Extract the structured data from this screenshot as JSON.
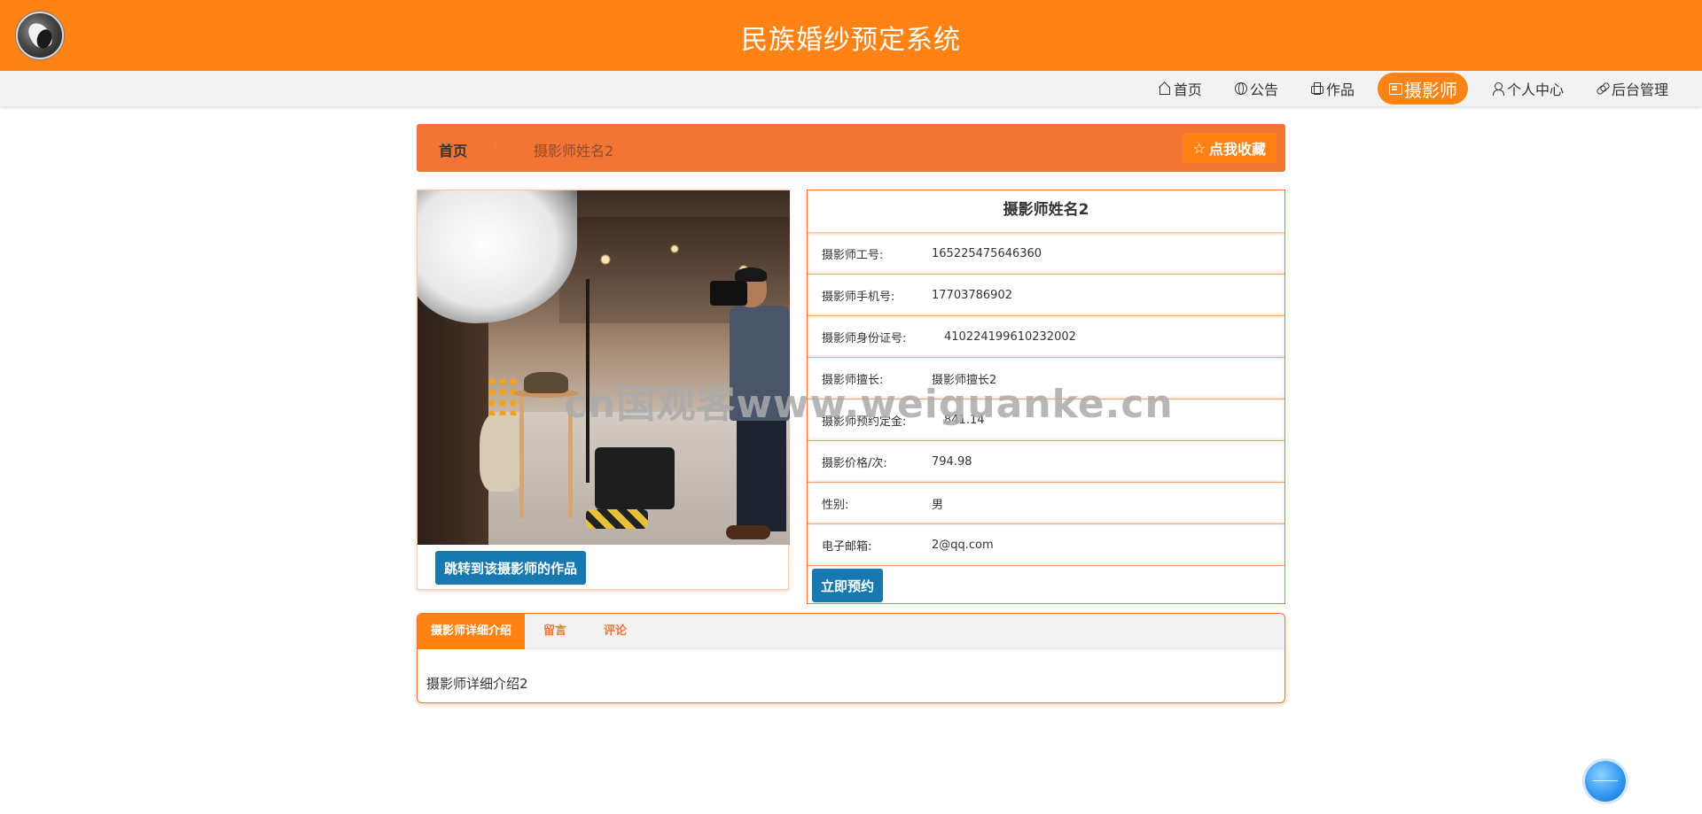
{
  "header": {
    "site_title": "民族婚纱预定系统"
  },
  "nav": {
    "items": [
      {
        "label": "首页",
        "icon": "home-icon"
      },
      {
        "label": "公告",
        "icon": "globe-icon"
      },
      {
        "label": "作品",
        "icon": "print-icon"
      },
      {
        "label": "摄影师",
        "icon": "card-icon",
        "active": true
      },
      {
        "label": "个人中心",
        "icon": "user-icon"
      },
      {
        "label": "后台管理",
        "icon": "link-icon"
      }
    ]
  },
  "breadcrumb": {
    "home": "首页",
    "separator": "/",
    "current": "摄影师姓名2",
    "favorite_label": "点我收藏"
  },
  "photo_panel": {
    "works_button": "跳转到该摄影师的作品"
  },
  "detail": {
    "title": "摄影师姓名2",
    "rows": [
      {
        "label": "摄影师工号:",
        "value": "165225475646360"
      },
      {
        "label": "摄影师手机号:",
        "value": "17703786902"
      },
      {
        "label": "摄影师身份证号:",
        "value": "410224199610232002"
      },
      {
        "label": "摄影师擅长:",
        "value": "摄影师擅长2"
      },
      {
        "label": "摄影师预约定金:",
        "value": "841.14"
      },
      {
        "label": "摄影价格/次:",
        "value": "794.98"
      },
      {
        "label": "性别:",
        "value": "男"
      },
      {
        "label": "电子邮箱:",
        "value": "2@qq.com"
      }
    ],
    "book_button": "立即预约"
  },
  "tabs": {
    "items": [
      "摄影师详细介绍",
      "留言",
      "评论"
    ],
    "content": "摄影师详细介绍2"
  },
  "watermark": "cn国观客www.weiguanke.cn",
  "colors": {
    "primary": "#fe8314",
    "breadcrumb_bg": "#f37535",
    "button_blue": "#1779b0"
  }
}
